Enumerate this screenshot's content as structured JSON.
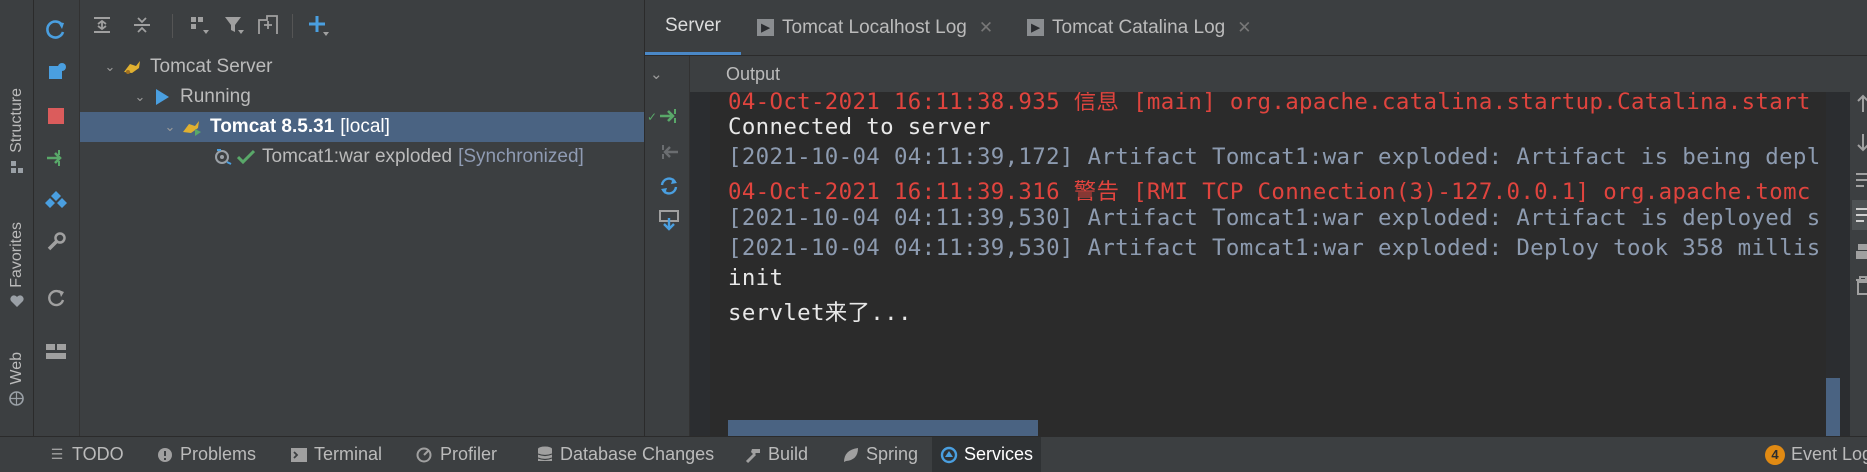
{
  "left_strip": {
    "structure_label": "Structure",
    "favorites_label": "Favorites",
    "web_label": "Web"
  },
  "tree": {
    "server_group": "Tomcat Server",
    "status_group": "Running",
    "instance_name": "Tomcat 8.5.31",
    "instance_tag": "[local]",
    "artifact_name": "Tomcat1:war exploded",
    "artifact_status": "[Synchronized]"
  },
  "tabs": [
    {
      "label": "Server",
      "active": true
    },
    {
      "label": "Tomcat Localhost Log",
      "active": false
    },
    {
      "label": "Tomcat Catalina Log",
      "active": false
    }
  ],
  "output": {
    "title": "Output",
    "lines": [
      {
        "text": "04-Oct-2021 16:11:38.935 信息 [main] org.apache.catalina.startup.Catalina.start",
        "color": "#e0443e"
      },
      {
        "text": "Connected to server",
        "color": "#e8e8e8"
      },
      {
        "text": "[2021-10-04 04:11:39,172] Artifact Tomcat1:war exploded: Artifact is being depl",
        "color": "#8d9bb0"
      },
      {
        "text": "04-Oct-2021 16:11:39.316 警告 [RMI TCP Connection(3)-127.0.0.1] org.apache.tomc",
        "color": "#e0443e"
      },
      {
        "text": "[2021-10-04 04:11:39,530] Artifact Tomcat1:war exploded: Artifact is deployed s",
        "color": "#8d9bb0"
      },
      {
        "text": "[2021-10-04 04:11:39,530] Artifact Tomcat1:war exploded: Deploy took 358 millis",
        "color": "#8d9bb0"
      },
      {
        "text": "init",
        "color": "#e8e8e8"
      },
      {
        "text": "servlet来了...",
        "color": "#e8e8e8"
      }
    ]
  },
  "status_bar": {
    "todo": "TODO",
    "problems": "Problems",
    "terminal": "Terminal",
    "profiler": "Profiler",
    "database_changes": "Database Changes",
    "build": "Build",
    "spring": "Spring",
    "services": "Services",
    "event_log_count": "4",
    "event_log": "Event Log"
  },
  "colors": {
    "accent": "#4a88c7",
    "selection": "#4a6382",
    "error_text": "#e0443e",
    "run_green": "#59a869",
    "stop_red": "#db5c5c"
  }
}
